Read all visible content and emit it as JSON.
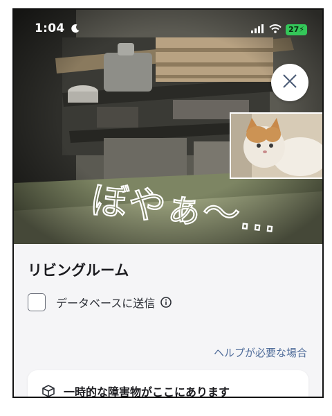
{
  "status_bar": {
    "time": "1:04",
    "battery": "27"
  },
  "camera": {
    "overlay_text": "ぼやぁ〜…"
  },
  "room": {
    "title": "リビングルーム"
  },
  "database_option": {
    "label": "データベースに送信",
    "checked": false
  },
  "help_link": "ヘルプが必要な場合",
  "notice_card": {
    "text": "一時的な障害物がここにあります"
  },
  "icons": {
    "moon": "moon-icon",
    "signal": "signal-icon",
    "wifi": "wifi-icon",
    "battery": "battery-icon",
    "close": "close-icon",
    "info": "info-icon",
    "cube": "cube-icon"
  },
  "colors": {
    "battery": "#34c759",
    "link": "#4f6c9a",
    "background": "#f5f5f7"
  }
}
